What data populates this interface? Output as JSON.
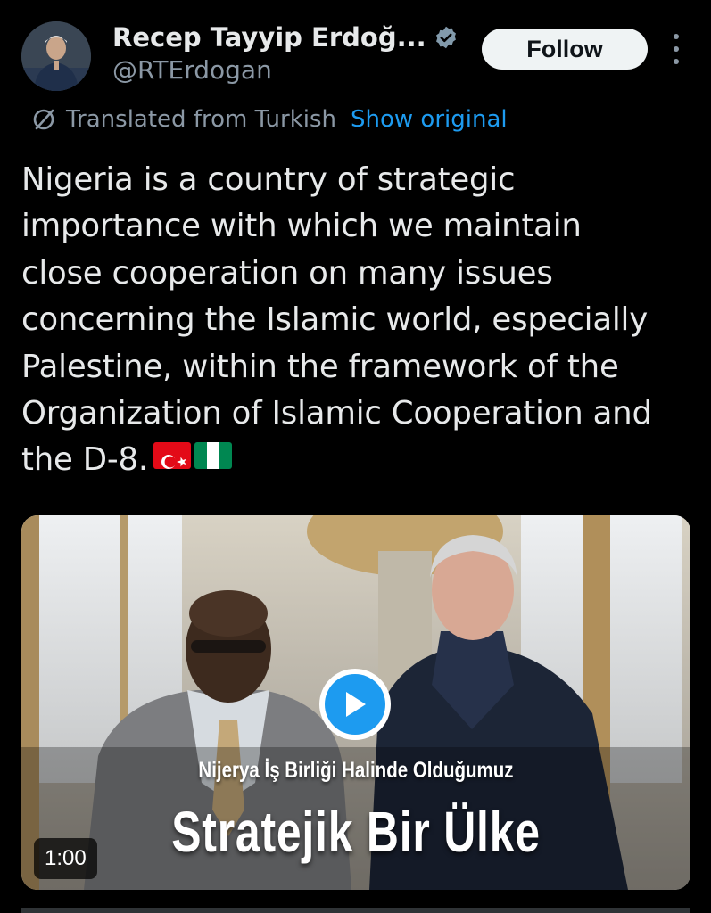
{
  "author": {
    "display_name": "Recep Tayyip Erdoğ...",
    "handle": "@RTErdogan",
    "avatar_icon": "profile-photo",
    "verified_icon": "verified-badge-icon"
  },
  "actions": {
    "follow_label": "Follow",
    "more_icon": "more-vertical-icon"
  },
  "translation": {
    "label": "Translated from Turkish",
    "show_original_label": "Show original"
  },
  "tweet": {
    "lines": [
      "Nigeria is a country of strategic",
      "importance with which we maintain",
      "close cooperation on many issues",
      "concerning the Islamic world, especially",
      "Palestine, within the framework of the",
      "Organization of Islamic Cooperation and",
      "the D-8."
    ],
    "flags": [
      "flag-turkey",
      "flag-nigeria"
    ]
  },
  "media": {
    "caption_line1": "Nijerya İş Birliği Halinde Olduğumuz",
    "caption_line2": "Stratejik Bir Ülke",
    "duration": "1:00",
    "play_icon": "play-icon"
  },
  "colors": {
    "background": "#000000",
    "text": "#e7e9ea",
    "secondary": "#8b98a5",
    "link": "#1d9bf0",
    "verified": "#829aab"
  }
}
